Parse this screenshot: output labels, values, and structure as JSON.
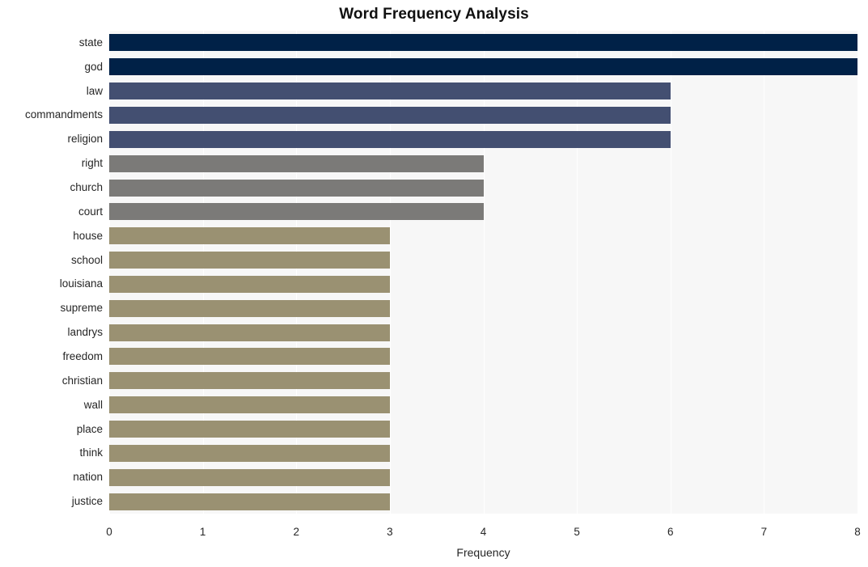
{
  "chart_data": {
    "type": "bar",
    "orientation": "horizontal",
    "title": "Word Frequency Analysis",
    "xlabel": "Frequency",
    "ylabel": "",
    "xlim": [
      0,
      8
    ],
    "xticks": [
      0,
      1,
      2,
      3,
      4,
      5,
      6,
      7,
      8
    ],
    "grid": true,
    "legend": false,
    "categories": [
      "state",
      "god",
      "law",
      "commandments",
      "religion",
      "right",
      "church",
      "court",
      "house",
      "school",
      "louisiana",
      "supreme",
      "landrys",
      "freedom",
      "christian",
      "wall",
      "place",
      "think",
      "nation",
      "justice"
    ],
    "values": [
      8,
      8,
      6,
      6,
      6,
      4,
      4,
      4,
      3,
      3,
      3,
      3,
      3,
      3,
      3,
      3,
      3,
      3,
      3,
      3
    ],
    "bar_colors": [
      "#002147",
      "#002147",
      "#434f71",
      "#434f71",
      "#434f71",
      "#7b7a78",
      "#7b7a78",
      "#7b7a78",
      "#9a9172",
      "#9a9172",
      "#9a9172",
      "#9a9172",
      "#9a9172",
      "#9a9172",
      "#9a9172",
      "#9a9172",
      "#9a9172",
      "#9a9172",
      "#9a9172",
      "#9a9172"
    ],
    "palette": {
      "tier_8": "#002147",
      "tier_6": "#434f71",
      "tier_4": "#7b7a78",
      "tier_3": "#9a9172"
    },
    "plot_background": "#f7f7f7",
    "gridline_color": "#ffffff",
    "figure_background": "#ffffff"
  }
}
